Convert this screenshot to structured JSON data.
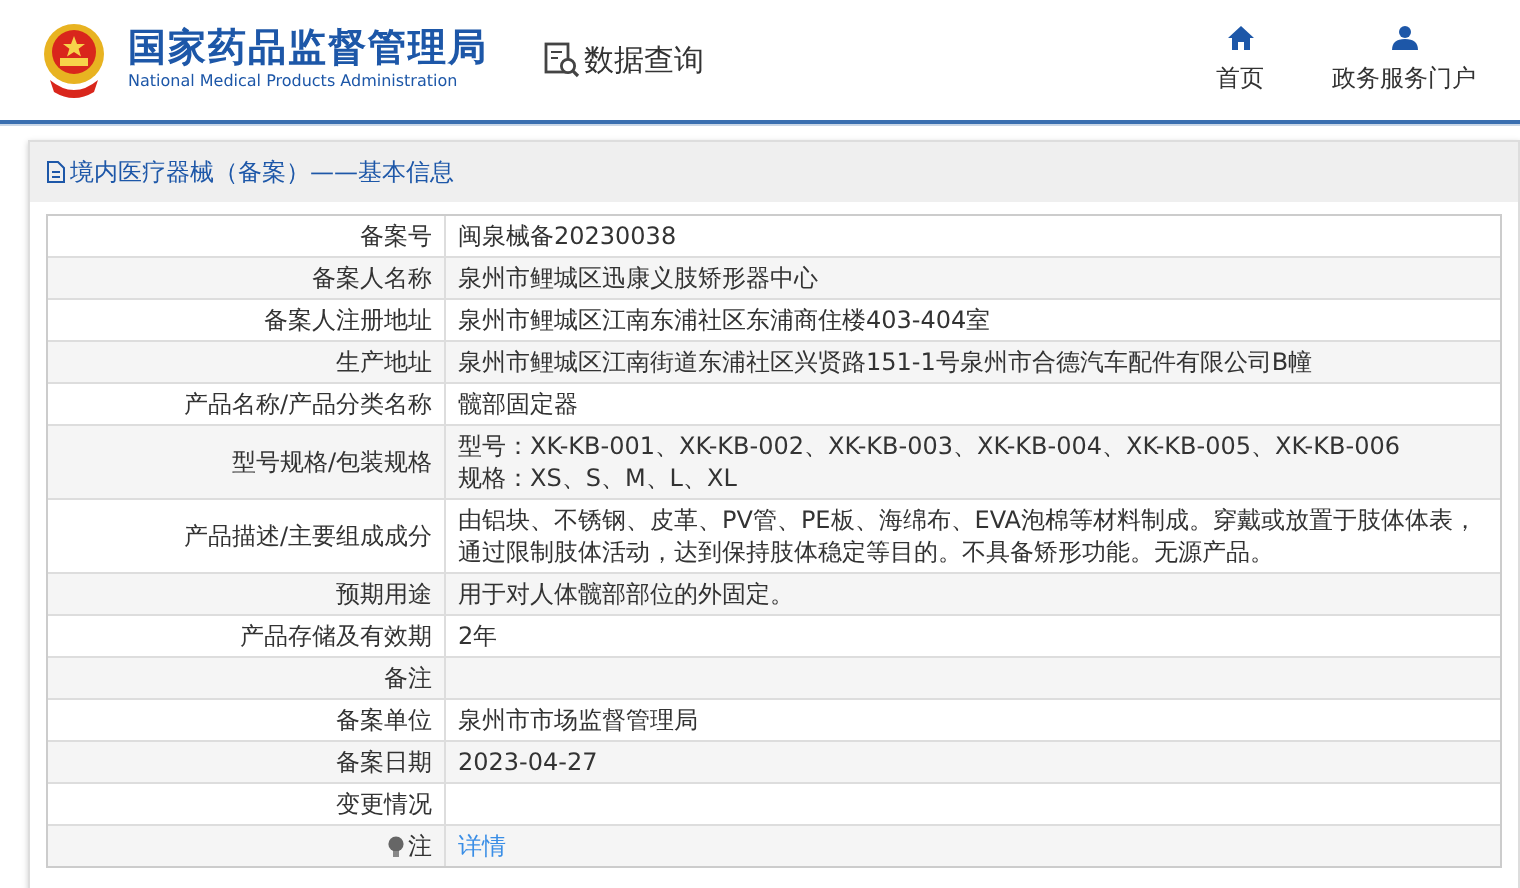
{
  "header": {
    "title": "国家药品监督管理局",
    "subtitle": "National Medical Products Administration",
    "query": "数据查询",
    "nav": [
      {
        "label": "首页",
        "kind": "home"
      },
      {
        "label": "政务服务门户",
        "kind": "user"
      }
    ]
  },
  "panel": {
    "title": "境内医疗器械（备案）——基本信息"
  },
  "rows": [
    {
      "label": "备案号",
      "lines": [
        "闽泉械备20230038"
      ]
    },
    {
      "label": "备案人名称",
      "lines": [
        "泉州市鲤城区迅康义肢矫形器中心"
      ]
    },
    {
      "label": "备案人注册地址",
      "lines": [
        "泉州市鲤城区江南东浦社区东浦商住楼403-404室"
      ]
    },
    {
      "label": "生产地址",
      "lines": [
        "泉州市鲤城区江南街道东浦社区兴贤路151-1号泉州市合德汽车配件有限公司B幢"
      ]
    },
    {
      "label": "产品名称/产品分类名称",
      "lines": [
        "髋部固定器"
      ]
    },
    {
      "label": "型号规格/包装规格",
      "lines": [
        "型号：XK-KB-001、XK-KB-002、XK-KB-003、XK-KB-004、XK-KB-005、XK-KB-006",
        "规格：XS、S、M、L、XL"
      ]
    },
    {
      "label": "产品描述/主要组成成分",
      "lines": [
        "由铝块、不锈钢、皮革、PV管、PE板、海绵布、EVA泡棉等材料制成。穿戴或放置于肢体体表，",
        "通过限制肢体活动，达到保持肢体稳定等目的。不具备矫形功能。无源产品。"
      ]
    },
    {
      "label": "预期用途",
      "lines": [
        "用于对人体髋部部位的外固定。"
      ]
    },
    {
      "label": "产品存储及有效期",
      "lines": [
        "2年"
      ]
    },
    {
      "label": "备注",
      "lines": []
    },
    {
      "label": "备案单位",
      "lines": [
        "泉州市市场监督管理局"
      ]
    },
    {
      "label": "备案日期",
      "lines": [
        "2023-04-27"
      ]
    },
    {
      "label": "变更情况",
      "lines": []
    },
    {
      "label": "注",
      "kind": "note",
      "link": "详情"
    }
  ]
}
